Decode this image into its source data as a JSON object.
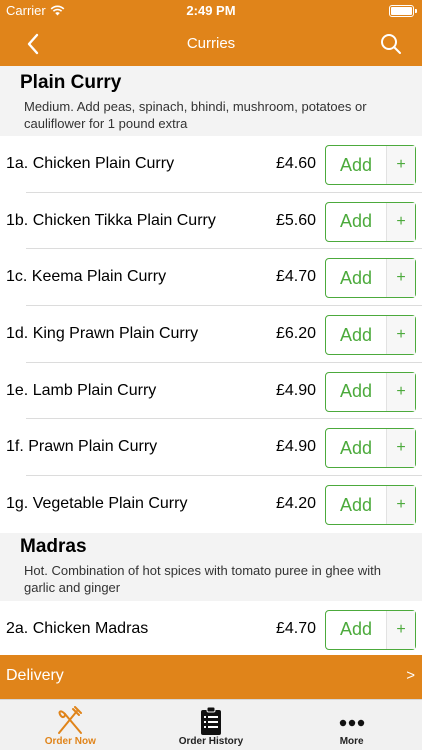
{
  "status_bar": {
    "carrier": "Carrier",
    "time": "2:49 PM"
  },
  "nav": {
    "title": "Curries"
  },
  "sections": [
    {
      "name": "Plain Curry",
      "description": "Medium. Add peas, spinach, bhindi, mushroom, potatoes or cauliflower for 1 pound extra",
      "items": [
        {
          "name": "1a. Chicken Plain Curry",
          "price": "£4.60"
        },
        {
          "name": "1b. Chicken Tikka Plain Curry",
          "price": "£5.60"
        },
        {
          "name": "1c. Keema Plain Curry",
          "price": "£4.70"
        },
        {
          "name": "1d. King Prawn Plain Curry",
          "price": "£6.20"
        },
        {
          "name": "1e. Lamb Plain Curry",
          "price": "£4.90"
        },
        {
          "name": "1f. Prawn Plain Curry",
          "price": "£4.90"
        },
        {
          "name": "1g. Vegetable Plain Curry",
          "price": "£4.20"
        }
      ]
    },
    {
      "name": "Madras",
      "description": "Hot. Combination of hot spices with tomato puree in ghee with garlic and ginger",
      "items": [
        {
          "name": "2a. Chicken Madras",
          "price": "£4.70"
        }
      ]
    }
  ],
  "buttons": {
    "add_label": "Add",
    "plus_label": "+"
  },
  "delivery": {
    "label": "Delivery",
    "chevron": ">"
  },
  "tabs": [
    {
      "label": "Order Now",
      "icon": "fork-knife-icon",
      "active": true
    },
    {
      "label": "Order History",
      "icon": "clipboard-icon",
      "active": false
    },
    {
      "label": "More",
      "icon": "more-dots-icon",
      "active": false
    }
  ],
  "colors": {
    "brand": "#e0841a",
    "add_green": "#4caa3c",
    "section_bg": "#f3f3f3"
  }
}
